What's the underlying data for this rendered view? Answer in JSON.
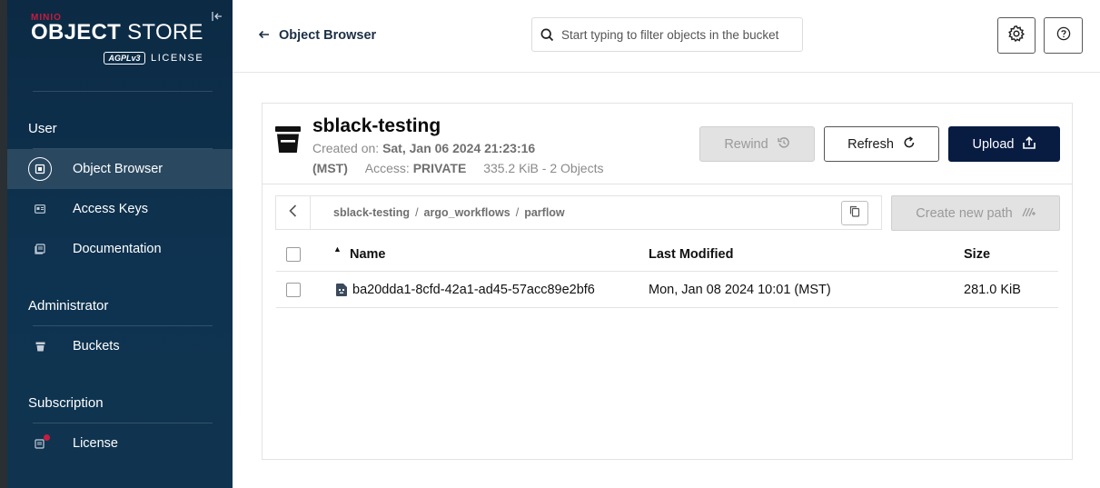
{
  "sidebar": {
    "logo": {
      "brand": "MINIO",
      "product_bold": "OBJECT",
      "product_rest": "STORE",
      "badge": "AGPLv3",
      "license_word": "LICENSE"
    },
    "sections": {
      "user": "User",
      "administrator": "Administrator",
      "subscription": "Subscription"
    },
    "items": {
      "object_browser": "Object Browser",
      "access_keys": "Access Keys",
      "documentation": "Documentation",
      "buckets": "Buckets",
      "license": "License"
    }
  },
  "topbar": {
    "back_label": "Object Browser",
    "search_placeholder": "Start typing to filter objects in the bucket"
  },
  "bucket": {
    "name": "sblack-testing",
    "created_label": "Created on:",
    "created_value": "Sat, Jan 06 2024 21:23:16",
    "created_tz": "(MST)",
    "access_label": "Access:",
    "access_value": "PRIVATE",
    "stats": "335.2 KiB - 2 Objects"
  },
  "buttons": {
    "rewind": "Rewind",
    "refresh": "Refresh",
    "upload": "Upload",
    "create_path": "Create new path"
  },
  "breadcrumb": [
    "sblack-testing",
    "argo_workflows",
    "parflow"
  ],
  "breadcrumb_sep": "/",
  "table": {
    "headers": {
      "name": "Name",
      "modified": "Last Modified",
      "size": "Size"
    },
    "rows": [
      {
        "name": "ba20dda1-8cfd-42a1-ad45-57acc89e2bf6",
        "modified": "Mon, Jan 08 2024 10:01 (MST)",
        "size": "281.0 KiB"
      }
    ]
  },
  "colors": {
    "sidebar": "#0c2a44",
    "accent_red": "#c51c3f",
    "primary": "#081c42",
    "disabled": "#e2e2e2"
  }
}
